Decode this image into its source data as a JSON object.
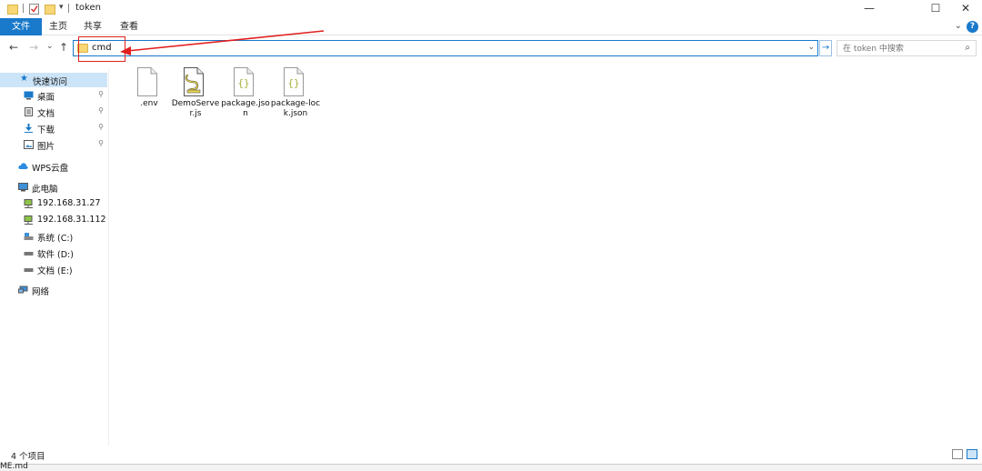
{
  "titlebar": {
    "title": "token",
    "controls": {
      "minimize": "—",
      "maximize": "☐",
      "close": "✕"
    },
    "qa_dropdown": "▾"
  },
  "ribbon": {
    "tabs": [
      "文件",
      "主页",
      "共享",
      "查看"
    ],
    "expand_chevron": "⌄",
    "help": "?"
  },
  "address": {
    "back": "←",
    "forward": "→",
    "recent": "⌄",
    "up": "↑",
    "path": "cmd",
    "dropdown": "⌄",
    "go": "→",
    "search_placeholder": "在 token 中搜索",
    "search_icon": "⌕"
  },
  "sidebar": {
    "items": [
      {
        "label": "快速访问",
        "icon": "star-icon",
        "selected": true
      },
      {
        "label": "桌面",
        "icon": "desktop-icon",
        "pinned": true
      },
      {
        "label": "文档",
        "icon": "document-icon",
        "pinned": true
      },
      {
        "label": "下载",
        "icon": "download-icon",
        "pinned": true
      },
      {
        "label": "图片",
        "icon": "picture-icon",
        "pinned": true
      },
      {
        "label": "WPS云盘",
        "icon": "cloud-icon"
      },
      {
        "label": "此电脑",
        "icon": "computer-icon"
      },
      {
        "label": "192.168.31.27",
        "icon": "network-drive-icon"
      },
      {
        "label": "192.168.31.112",
        "icon": "network-drive-icon"
      },
      {
        "label": "系统 (C:)",
        "icon": "drive-icon"
      },
      {
        "label": "软件 (D:)",
        "icon": "drive-icon"
      },
      {
        "label": "文档 (E:)",
        "icon": "drive-icon"
      },
      {
        "label": "网络",
        "icon": "network-icon"
      }
    ],
    "pin_glyph": "📌"
  },
  "files": [
    {
      "name": ".env",
      "icon": "blank-file-icon"
    },
    {
      "name": "DemoServer.js",
      "icon": "js-script-icon"
    },
    {
      "name": "package.json",
      "icon": "json-file-icon"
    },
    {
      "name": "package-lock.json",
      "icon": "json-file-icon"
    }
  ],
  "status": {
    "item_count": "4 个项目"
  },
  "background_fragment": "ME.md",
  "colors": {
    "accent": "#1979ca",
    "selection": "#cce4f7",
    "annotation_red": "#e02020",
    "folder": "#f8d775"
  }
}
